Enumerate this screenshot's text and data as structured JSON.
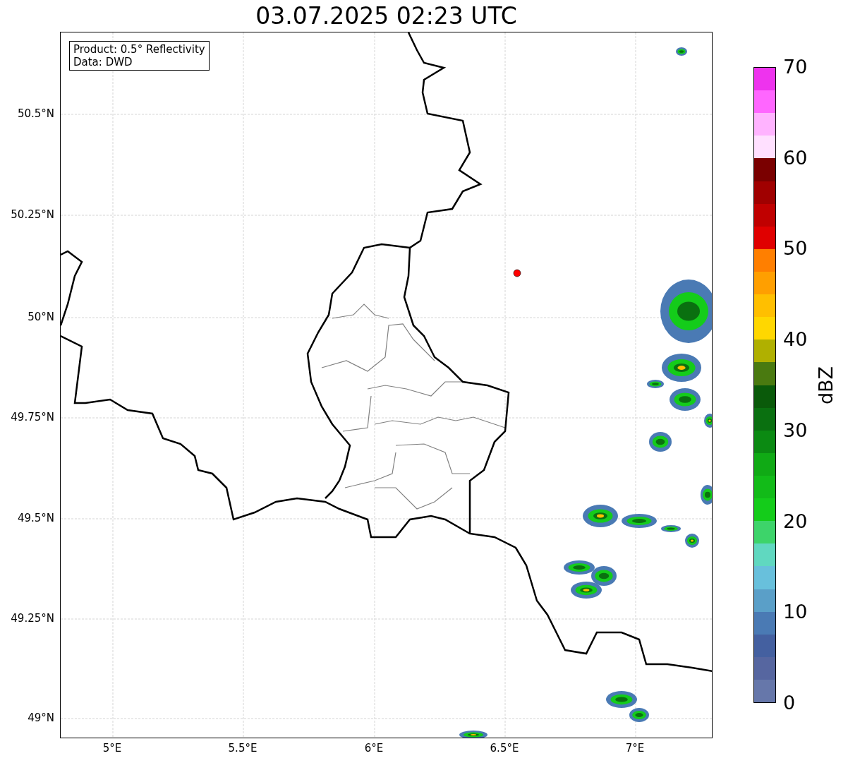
{
  "title": "03.07.2025 02:23 UTC",
  "legend": [
    "Product: 0.5° Reflectivity",
    "Data: DWD"
  ],
  "y_ticks": [
    "50.5°N",
    "50.25°N",
    "50°N",
    "49.75°N",
    "49.5°N",
    "49.25°N",
    "49°N"
  ],
  "x_ticks": [
    "5°E",
    "5.5°E",
    "6°E",
    "6.5°E",
    "7°E"
  ],
  "colorbar": {
    "label": "dBZ",
    "ticks": [
      "70",
      "60",
      "50",
      "40",
      "30",
      "20",
      "10",
      "0"
    ],
    "segments": [
      {
        "color": "#ee33ee"
      },
      {
        "color": "#ff66ff"
      },
      {
        "color": "#ffb3ff"
      },
      {
        "color": "#ffe0ff"
      },
      {
        "color": "#7a0000"
      },
      {
        "color": "#a00000"
      },
      {
        "color": "#c00000"
      },
      {
        "color": "#e00000"
      },
      {
        "color": "#ff7f00"
      },
      {
        "color": "#ff9f00"
      },
      {
        "color": "#ffbf00"
      },
      {
        "color": "#ffd700"
      },
      {
        "color": "#b0b000"
      },
      {
        "color": "#4a7a10"
      },
      {
        "color": "#0a5a0a"
      },
      {
        "color": "#0a7010"
      },
      {
        "color": "#0b8a12"
      },
      {
        "color": "#10aa15"
      },
      {
        "color": "#12bb18"
      },
      {
        "color": "#14cc1a"
      },
      {
        "color": "#3dd46a"
      },
      {
        "color": "#60d8c0"
      },
      {
        "color": "#68c0dc"
      },
      {
        "color": "#5a9fc8"
      },
      {
        "color": "#4a7ab4"
      },
      {
        "color": "#4460a0"
      },
      {
        "color": "#5666a0"
      },
      {
        "color": "#6677aa"
      }
    ]
  }
}
